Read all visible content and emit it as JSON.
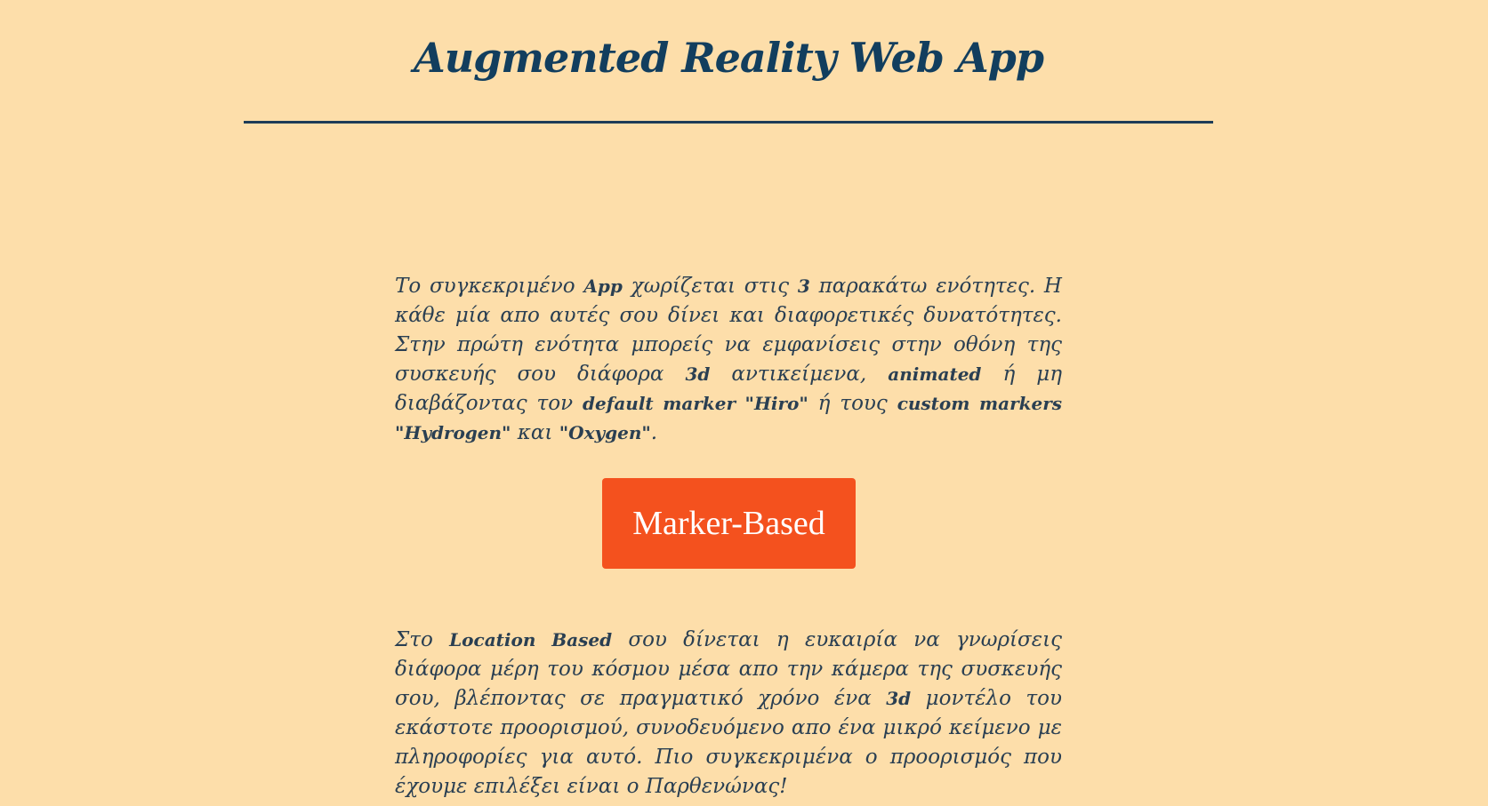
{
  "header": {
    "title": "Augmented Reality Web App"
  },
  "section1": {
    "p1": "Το συγκεκριμένο ",
    "b1": "App",
    "p2": " χωρίζεται στις ",
    "b2": "3",
    "p3": " παρακάτω ενότητες. Η κάθε μία απο αυτές σου δίνει και διαφορετικές δυνατότητες. Στην πρώτη ενότητα μπορείς να εμφανίσεις στην οθόνη της συσκευής σου διάφορα ",
    "b3": "3d",
    "p4": " αντικείμενα, ",
    "b4": "animated",
    "p5": " ή μη διαβάζοντας τον ",
    "b5": "default marker \"Hiro\"",
    "p6": " ή τους ",
    "b6": "custom markers \"Hydrogen\"",
    "p7": " και ",
    "b7": "\"Oxygen\"",
    "p8": "."
  },
  "button": {
    "label": "Marker-Based"
  },
  "section2": {
    "p1": "Στο ",
    "b1": "Location Based",
    "p2": " σου δίνεται η ευκαιρία να γνωρίσεις διάφορα μέρη του κόσμου μέσα απο την κάμερα της συσκευής σου, βλέποντας σε πραγματικό χρόνο ένα ",
    "b2": "3d",
    "p3": " μοντέλο του εκάστοτε προορισμού, συνοδευόμενο απο ένα μικρό κείμενο με πληροφορίες για αυτό. Πιο συγκεκριμένα ο προορισμός που έχουμε επιλέξει είναι ο Παρθενώνας!"
  }
}
